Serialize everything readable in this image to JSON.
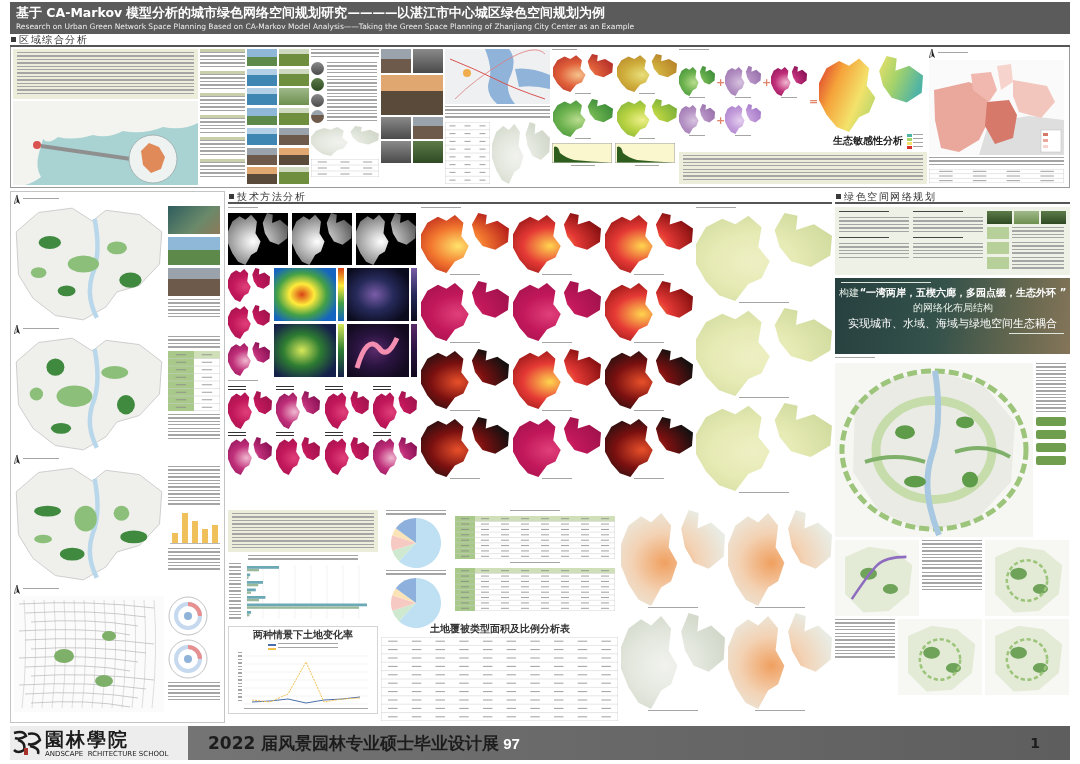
{
  "header": {
    "title": "基于 CA-Markov 模型分析的城市绿色网络空间规划研究————以湛江市中心城区绿色空间规划为例",
    "subtitle": "Research on Urban Green Network Space Planning Based on CA-Markov Model Analysis——Taking the Green Space Planning of Zhanjiang City Center as an Example"
  },
  "sections": [
    {
      "heading": "区域综合分析"
    },
    {
      "heading": "技术方法分析"
    },
    {
      "heading": "绿色空间网络规划"
    }
  ],
  "sensitivity": {
    "operators": [
      "+",
      "+",
      "+",
      "="
    ],
    "caption": "生态敏感性分析"
  },
  "change_chart": {
    "title": "两种情景下土地变化率"
  },
  "land_table": {
    "title": "土地覆被类型面积及比例分析表"
  },
  "network": {
    "lead": "构建",
    "slogan": "“一湾两岸，五楔六廊，多园点缀，生态外环 ”",
    "structure": "的网络化布局结构",
    "goal": "实现城市、水域、海域与绿地空间生态耦合"
  },
  "footer": {
    "logo": "園林學院",
    "logo_en": "ANDSCAPE  RCHITECTURE SCHOOL",
    "exhibition": "2022 届风景园林专业硕士毕业设计展",
    "number": "97",
    "page": "1"
  }
}
